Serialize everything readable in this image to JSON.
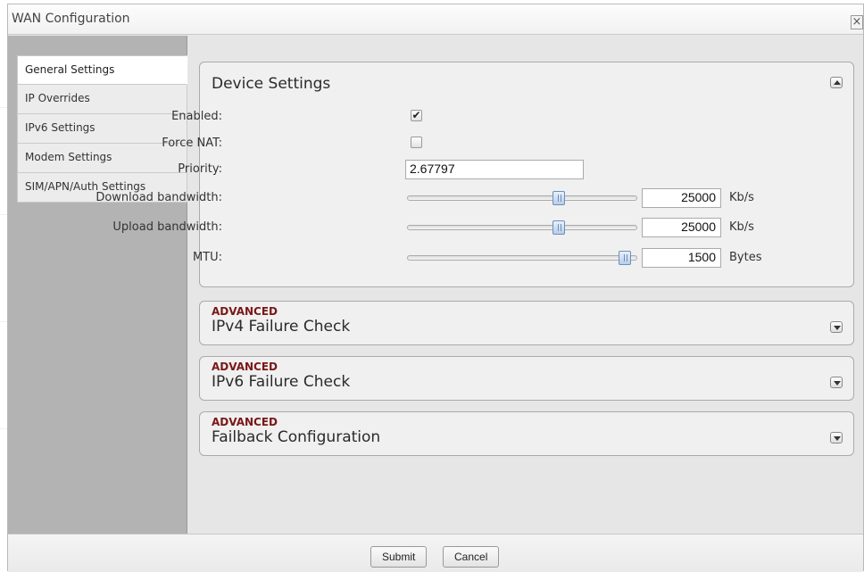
{
  "window": {
    "title": "WAN Configuration",
    "close_label": "×"
  },
  "sidebar": {
    "items": [
      {
        "label": "General Settings",
        "active": true
      },
      {
        "label": "IP Overrides",
        "active": false
      },
      {
        "label": "IPv6 Settings",
        "active": false
      },
      {
        "label": "Modem Settings",
        "active": false
      },
      {
        "label": "SIM/APN/Auth Settings",
        "active": false
      }
    ]
  },
  "device_settings": {
    "title": "Device Settings",
    "enabled": {
      "label": "Enabled:",
      "checked": true,
      "mark": "✔"
    },
    "force_nat": {
      "label": "Force NAT:",
      "checked": false,
      "mark": ""
    },
    "priority": {
      "label": "Priority:",
      "value": "2.67797"
    },
    "download": {
      "label": "Download bandwidth:",
      "value": "25000",
      "unit": "Kb/s",
      "level": 0.66
    },
    "upload": {
      "label": "Upload bandwidth:",
      "value": "25000",
      "unit": "Kb/s",
      "level": 0.66
    },
    "mtu": {
      "label": "MTU:",
      "value": "1500",
      "unit": "Bytes",
      "level": 0.95
    }
  },
  "advanced_panels": [
    {
      "tag": "ADVANCED",
      "title": "IPv4 Failure Check"
    },
    {
      "tag": "ADVANCED",
      "title": "IPv6 Failure Check"
    },
    {
      "tag": "ADVANCED",
      "title": "Failback Configuration"
    }
  ],
  "footer": {
    "submit_label": "Submit",
    "cancel_label": "Cancel"
  }
}
